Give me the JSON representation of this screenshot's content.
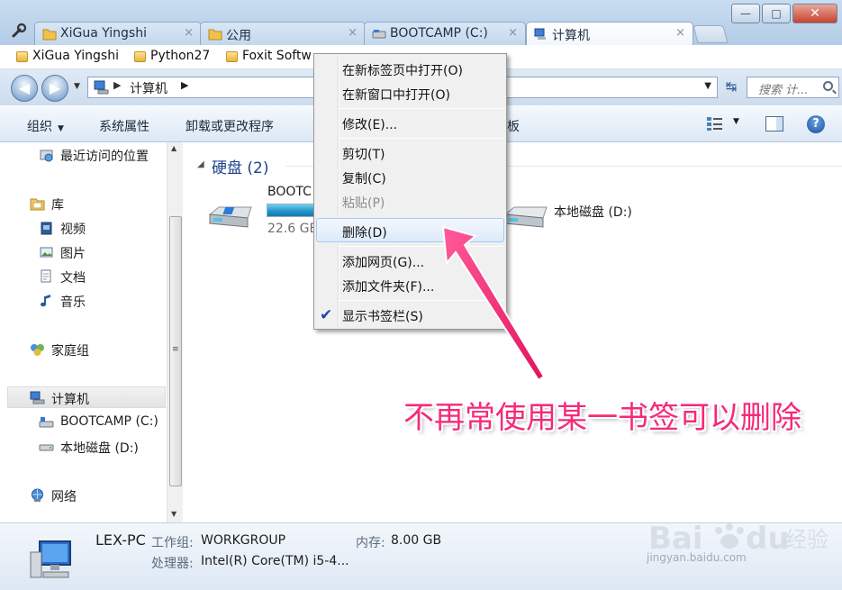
{
  "tabs": [
    {
      "label": "XiGua Yingshi",
      "close": "×",
      "icon": "folder-icon"
    },
    {
      "label": "公用",
      "close": "×",
      "icon": "folder-icon"
    },
    {
      "label": "BOOTCAMP (C:)",
      "close": "×",
      "icon": "drive-icon"
    },
    {
      "label": "计算机",
      "close": "×",
      "icon": "computer-icon",
      "active": true
    }
  ],
  "window_controls": {
    "minimize": "—",
    "maximize": "□",
    "close": "✕"
  },
  "bookmarks": [
    "XiGua Yingshi",
    "Python27",
    "Foxit Softw"
  ],
  "address": {
    "location": "计算机",
    "search_placeholder": "搜索 计..."
  },
  "commandbar": {
    "organize": "组织",
    "system_properties": "系统属性",
    "uninstall": "卸载或更改程序",
    "partial_item": "板"
  },
  "sidebar": {
    "recent": "最近访问的位置",
    "libraries": "库",
    "videos": "视频",
    "pictures": "图片",
    "documents": "文档",
    "music": "音乐",
    "homegroup": "家庭组",
    "computer": "计算机",
    "bootcamp": "BOOTCAMP (C:)",
    "local_disk": "本地磁盘 (D:)",
    "network": "网络"
  },
  "main": {
    "group_header": "硬盘 (2)",
    "drives": [
      {
        "name": "BOOTC",
        "free": "22.6 GB",
        "usage_fraction": 0.85
      },
      {
        "name": "本地磁盘 (D:)"
      }
    ]
  },
  "details": {
    "pc_name": "LEX-PC",
    "workgroup_label": "工作组:",
    "workgroup": "WORKGROUP",
    "memory_label": "内存:",
    "memory": "8.00 GB",
    "processor_label": "处理器:",
    "processor": "Intel(R) Core(TM) i5-4..."
  },
  "context_menu": {
    "items": [
      {
        "label": "在新标签页中打开(O)"
      },
      {
        "label": "在新窗口中打开(O)"
      },
      {
        "label": "修改(E)..."
      },
      {
        "label": "剪切(T)"
      },
      {
        "label": "复制(C)"
      },
      {
        "label": "粘贴(P)",
        "disabled": true
      },
      {
        "label": "删除(D)",
        "highlighted": true
      },
      {
        "label": "添加网页(G)..."
      },
      {
        "label": "添加文件夹(F)..."
      },
      {
        "label": "显示书签栏(S)",
        "checked": true
      }
    ],
    "check_glyph": "✔"
  },
  "annotation": {
    "text": "不再常使用某一书签可以删除",
    "color": "#f52a7a"
  },
  "watermark": {
    "brand": "Baidu经验",
    "url": "jingyan.baidu.com"
  },
  "colors": {
    "accent": "#1e3f8c",
    "drive_fill": "#1f93c9",
    "arrow": "#f52a7a"
  }
}
